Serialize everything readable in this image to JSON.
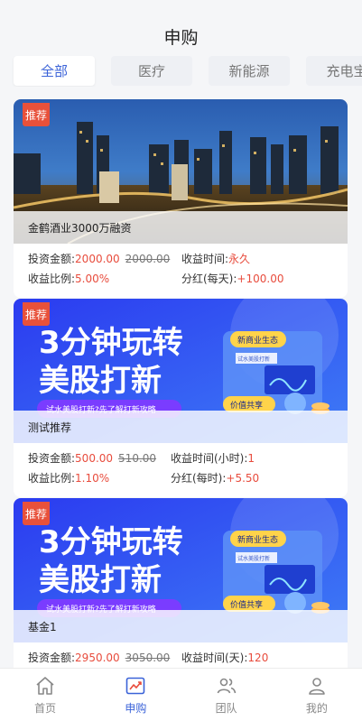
{
  "header": {
    "title": "申购"
  },
  "tabs": [
    {
      "label": "全部",
      "active": true
    },
    {
      "label": "医疗",
      "active": false
    },
    {
      "label": "新能源",
      "active": false
    },
    {
      "label": "充电宝",
      "active": false
    }
  ],
  "badge_label": "推荐",
  "cards": [
    {
      "name": "金鹤酒业3000万融资",
      "invest_label": "投资金额:",
      "invest_value": "2000.00",
      "invest_original": "2000.00",
      "period_label": "收益时间:",
      "period_value": "永久",
      "ratio_label": "收益比例:",
      "ratio_value": "5.00%",
      "dividend_label": "分红(每天):",
      "dividend_value": "+100.00",
      "banner": "city-night"
    },
    {
      "name": "测试推荐",
      "invest_label": "投资金额:",
      "invest_value": "500.00",
      "invest_original": "510.00",
      "period_label": "收益时间(小时):",
      "period_value": "1",
      "ratio_label": "收益比例:",
      "ratio_value": "1.10%",
      "dividend_label": "分红(每时):",
      "dividend_value": "+5.50",
      "banner": "promo"
    },
    {
      "name": "基金1",
      "invest_label": "投资金额:",
      "invest_value": "2950.00",
      "invest_original": "3050.00",
      "period_label": "收益时间(天):",
      "period_value": "120",
      "banner": "promo"
    }
  ],
  "promo": {
    "line1": "3分钟玩转",
    "line2": "美股打新",
    "ribbon": "试水美股打新?先了解打新攻略",
    "tag_top": "新商业生态",
    "tag_mid": "试水美股打新",
    "tag_bottom": "价值共享"
  },
  "nav": [
    {
      "label": "首页",
      "icon": "home-icon",
      "active": false
    },
    {
      "label": "申购",
      "icon": "trend-chart-icon",
      "active": true
    },
    {
      "label": "团队",
      "icon": "team-icon",
      "active": false
    },
    {
      "label": "我的",
      "icon": "user-icon",
      "active": false
    }
  ],
  "colors": {
    "accent": "#3b63d8",
    "red": "#e84c3d",
    "badge": "#e8513a"
  }
}
